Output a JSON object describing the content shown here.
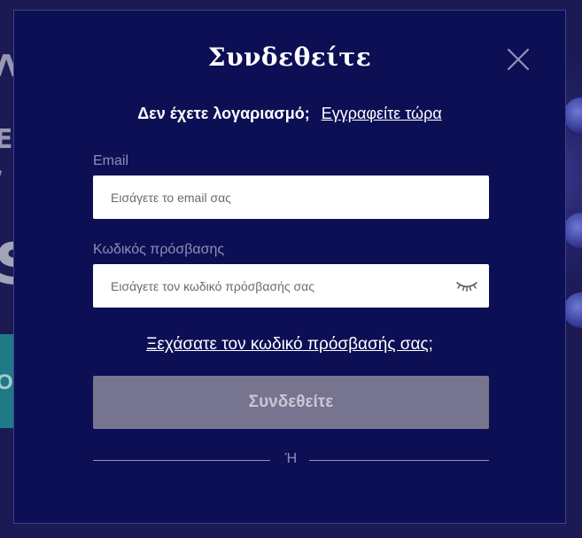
{
  "modal": {
    "title": "Συνδεθείτε",
    "signup_prompt": "Δεν έχετε λογαριασμό;",
    "signup_link": "Εγγραφείτε τώρα",
    "email_label": "Email",
    "email_placeholder": "Εισάγετε το email σας",
    "email_value": "",
    "password_label": "Κωδικός πρόσβασης",
    "password_placeholder": "Εισάγετε τον κωδικό πρόσβασής σας",
    "password_value": "",
    "forgot_link": "Ξεχάσατε τον κωδικό πρόσβασής σας;",
    "submit_label": "Συνδεθείτε",
    "divider_text": "Ή"
  },
  "icons": {
    "close": "close-icon",
    "password_toggle": "eye-closed-icon"
  },
  "colors": {
    "modal_background": "#0d0f55",
    "page_background": "#1b1a52",
    "submit_disabled": "#77748f",
    "label_muted": "#8b8fb5",
    "text": "#ffffff"
  }
}
